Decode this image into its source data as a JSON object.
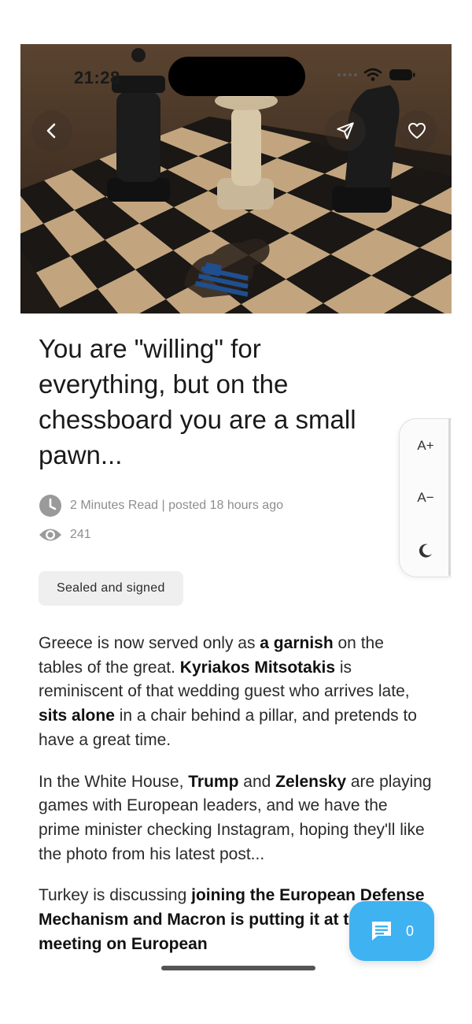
{
  "status_bar": {
    "time": "21:28"
  },
  "article": {
    "title": "You are \"willing\" for everything, but on the chessboard you are a small pawn...",
    "read_meta": "2 Minutes Read | posted 18 hours ago",
    "views": "241",
    "tag": "Sealed and signed",
    "paragraphs": [
      [
        {
          "t": "Greece is now served only as "
        },
        {
          "t": "a garnish",
          "b": true
        },
        {
          "t": " on the tables of the great. "
        },
        {
          "t": "Kyriakos Mitsotakis",
          "b": true
        },
        {
          "t": " is reminiscent of that wedding guest who arrives late, "
        },
        {
          "t": "sits alone",
          "b": true
        },
        {
          "t": " in a chair behind a pillar, and pretends to have a great time."
        }
      ],
      [
        {
          "t": "In the White House, "
        },
        {
          "t": "Trump",
          "b": true
        },
        {
          "t": " and "
        },
        {
          "t": "Zelensky",
          "b": true
        },
        {
          "t": " are playing games with European leaders, and we have the prime minister checking Instagram, hoping they'll like the photo from his latest post..."
        }
      ],
      [
        {
          "t": "Turkey is discussing "
        },
        {
          "t": "joining the European Defense Mechanism and Macron is putting it at the closed meeting on European",
          "b": true
        }
      ]
    ]
  },
  "text_controls": {
    "increase": "A+",
    "decrease": "A−"
  },
  "comments": {
    "count": "0"
  },
  "icons": {
    "back": "chevron-left-icon",
    "share": "send-icon",
    "favorite": "heart-icon",
    "clock": "clock-icon",
    "views": "eye-icon",
    "dark_mode": "moon-icon",
    "comments": "comment-icon"
  },
  "colors": {
    "accent": "#3fb2f2",
    "meta": "#8e8e8e",
    "tag_bg": "#efefef"
  }
}
